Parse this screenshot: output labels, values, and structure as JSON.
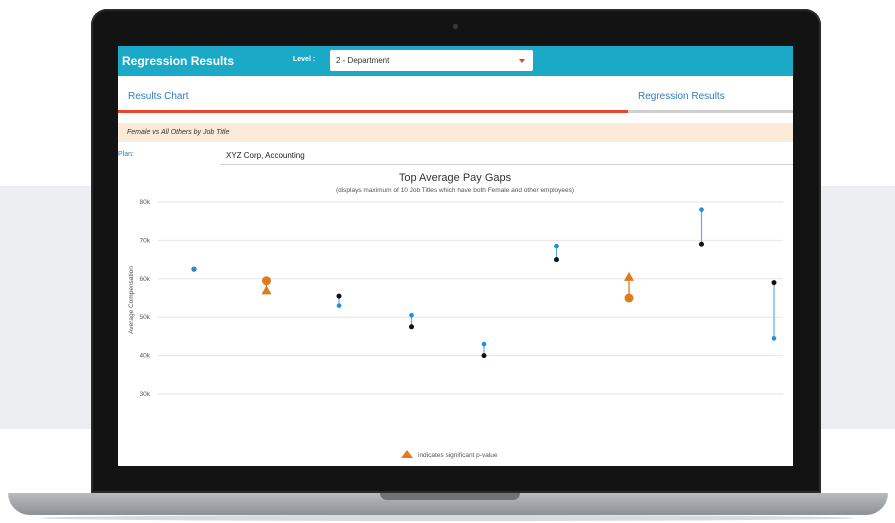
{
  "app": {
    "title": "Regression Results",
    "level_label": "Level :",
    "level_value": "2 - Department"
  },
  "tabs": [
    {
      "label": "Results Chart",
      "active": true
    },
    {
      "label": "Regression Results",
      "active": false
    }
  ],
  "subheader": "Female vs All Others by Job Title",
  "plan": {
    "label": "Plan:",
    "value": "XYZ Corp, Accounting"
  },
  "colors": {
    "accent": "#1aaac8",
    "tab_active": "#e8452b",
    "female": "#1f8fd8",
    "others": "#111111",
    "significant": "#e07a1f"
  },
  "chart_data": {
    "type": "scatter",
    "title": "Top Average Pay Gaps",
    "subtitle": "(displays maximum of 10 Job Titles which have both Female and other employees)",
    "ylabel": "Average Compensation",
    "ylim": [
      30,
      80
    ],
    "yticks": [
      30,
      40,
      50,
      60,
      70,
      80
    ],
    "ytick_labels": [
      "30k",
      "40k",
      "50k",
      "60k",
      "70k",
      "80k"
    ],
    "legend": {
      "label": "indicates significant p-value",
      "position": "bottom-center"
    },
    "points": [
      {
        "female": 62.5,
        "others": 62.5,
        "significant": false
      },
      {
        "female": 57.0,
        "others": 59.5,
        "significant": true,
        "sig_marker": "female"
      },
      {
        "female": 53.0,
        "others": 55.5,
        "significant": false
      },
      {
        "female": 50.5,
        "others": 47.5,
        "significant": false
      },
      {
        "female": 43.0,
        "others": 40.0,
        "significant": false
      },
      {
        "female": 68.5,
        "others": 65.0,
        "significant": false
      },
      {
        "female": 60.5,
        "others": 55.0,
        "significant": true,
        "sig_marker": "female"
      },
      {
        "female": 78.0,
        "others": 69.0,
        "significant": false
      },
      {
        "female": 44.5,
        "others": 59.0,
        "significant": false
      }
    ]
  }
}
